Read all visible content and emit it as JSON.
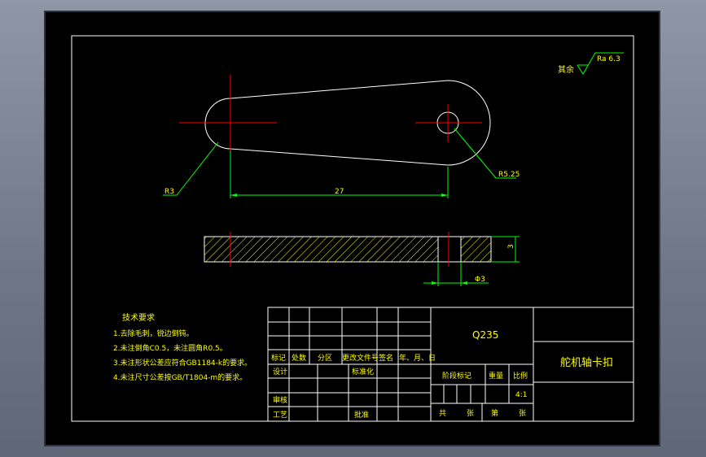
{
  "drawing": {
    "roughness": {
      "prefix": "其余",
      "value": "Ra 6.3"
    },
    "dimensions": {
      "left_radius": "R3",
      "right_radius": "R5.25",
      "center_distance": "27",
      "thickness": "3",
      "hole_diameter": "Φ3"
    },
    "tech_requirements": {
      "title": "技术要求",
      "items": [
        "1.去除毛刺，锐边倒钝。",
        "2.未注倒角C0.5，未注圆角R0.5。",
        "3.未注形状公差应符合GB1184-k的要求。",
        "4.未注尺寸公差按GB/T1804-m的要求。"
      ]
    },
    "title_block": {
      "material": "Q235",
      "part_name": "舵机轴卡扣",
      "revision_headers": [
        "标记",
        "处数",
        "分区",
        "更改文件号",
        "签名",
        "年、月、日"
      ],
      "design": "设计",
      "standardization": "标准化",
      "stage_mark": "阶段标记",
      "weight": "重量",
      "scale_label": "比例",
      "scale_value": "4:1",
      "review": "审核",
      "process": "工艺",
      "approve": "批准",
      "total": "共",
      "sheet": "张",
      "page_num": "第",
      "page": "张"
    }
  }
}
